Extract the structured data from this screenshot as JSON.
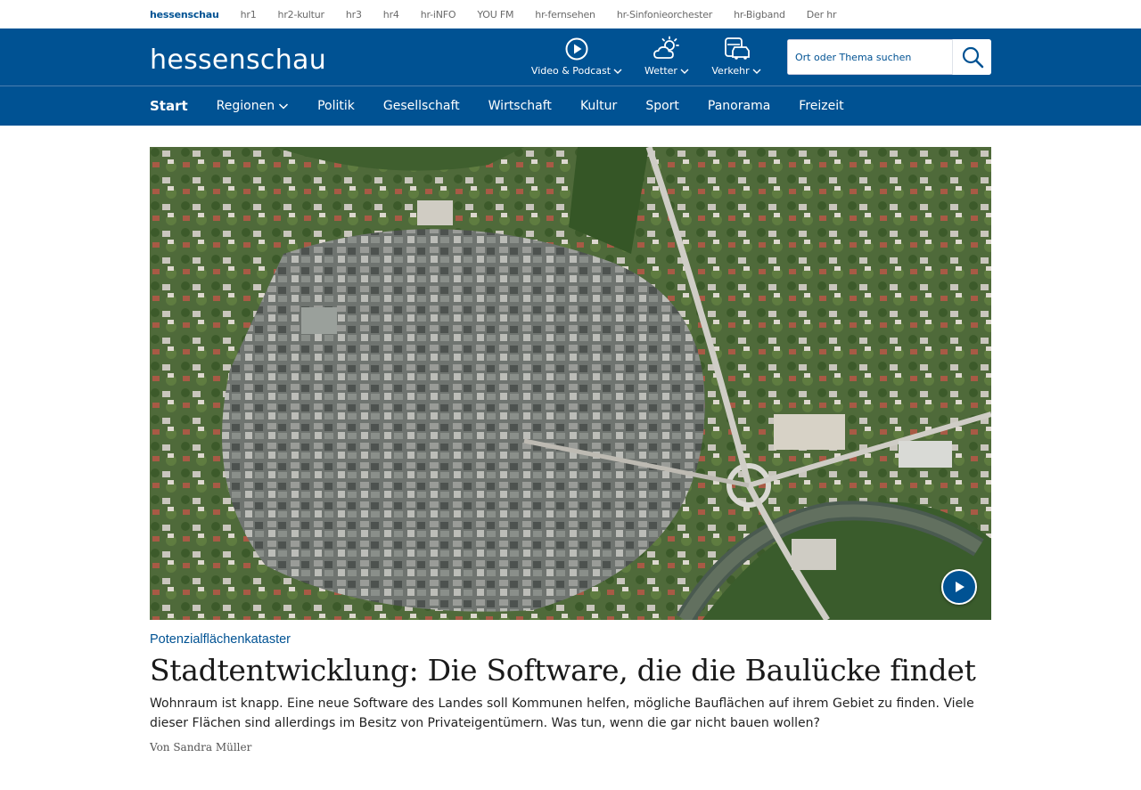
{
  "network_bar": {
    "items": [
      "hessenschau",
      "hr1",
      "hr2-kultur",
      "hr3",
      "hr4",
      "hr-iNFO",
      "YOU FM",
      "hr-fernsehen",
      "hr-Sinfonieorchester",
      "hr-Bigband",
      "Der hr"
    ]
  },
  "header": {
    "logo": "hessenschau",
    "video_label": "Video & Podcast",
    "weather_label": "Wetter",
    "traffic_label": "Verkehr",
    "search_placeholder": "Ort oder Thema suchen"
  },
  "nav": {
    "items": [
      "Start",
      "Regionen",
      "Politik",
      "Gesellschaft",
      "Wirtschaft",
      "Kultur",
      "Sport",
      "Panorama",
      "Freizeit"
    ]
  },
  "teaser": {
    "topline": "Potenzialflächenkataster",
    "headline": "Stadtentwicklung: Die Software, die die Baulücke findet",
    "text": "Wohnraum ist knapp. Eine neue Software des Landes soll Kommunen helfen, mögliche Bauflächen auf ihrem Gebiet zu finden. Viele dieser Flächen sind allerdings im Besitz von Privateigentümern. Was tun, wenn die gar nicht bauen wollen?",
    "author": "Von Sandra Müller"
  },
  "colors": {
    "brand_blue": "#005293",
    "white": "#ffffff"
  }
}
